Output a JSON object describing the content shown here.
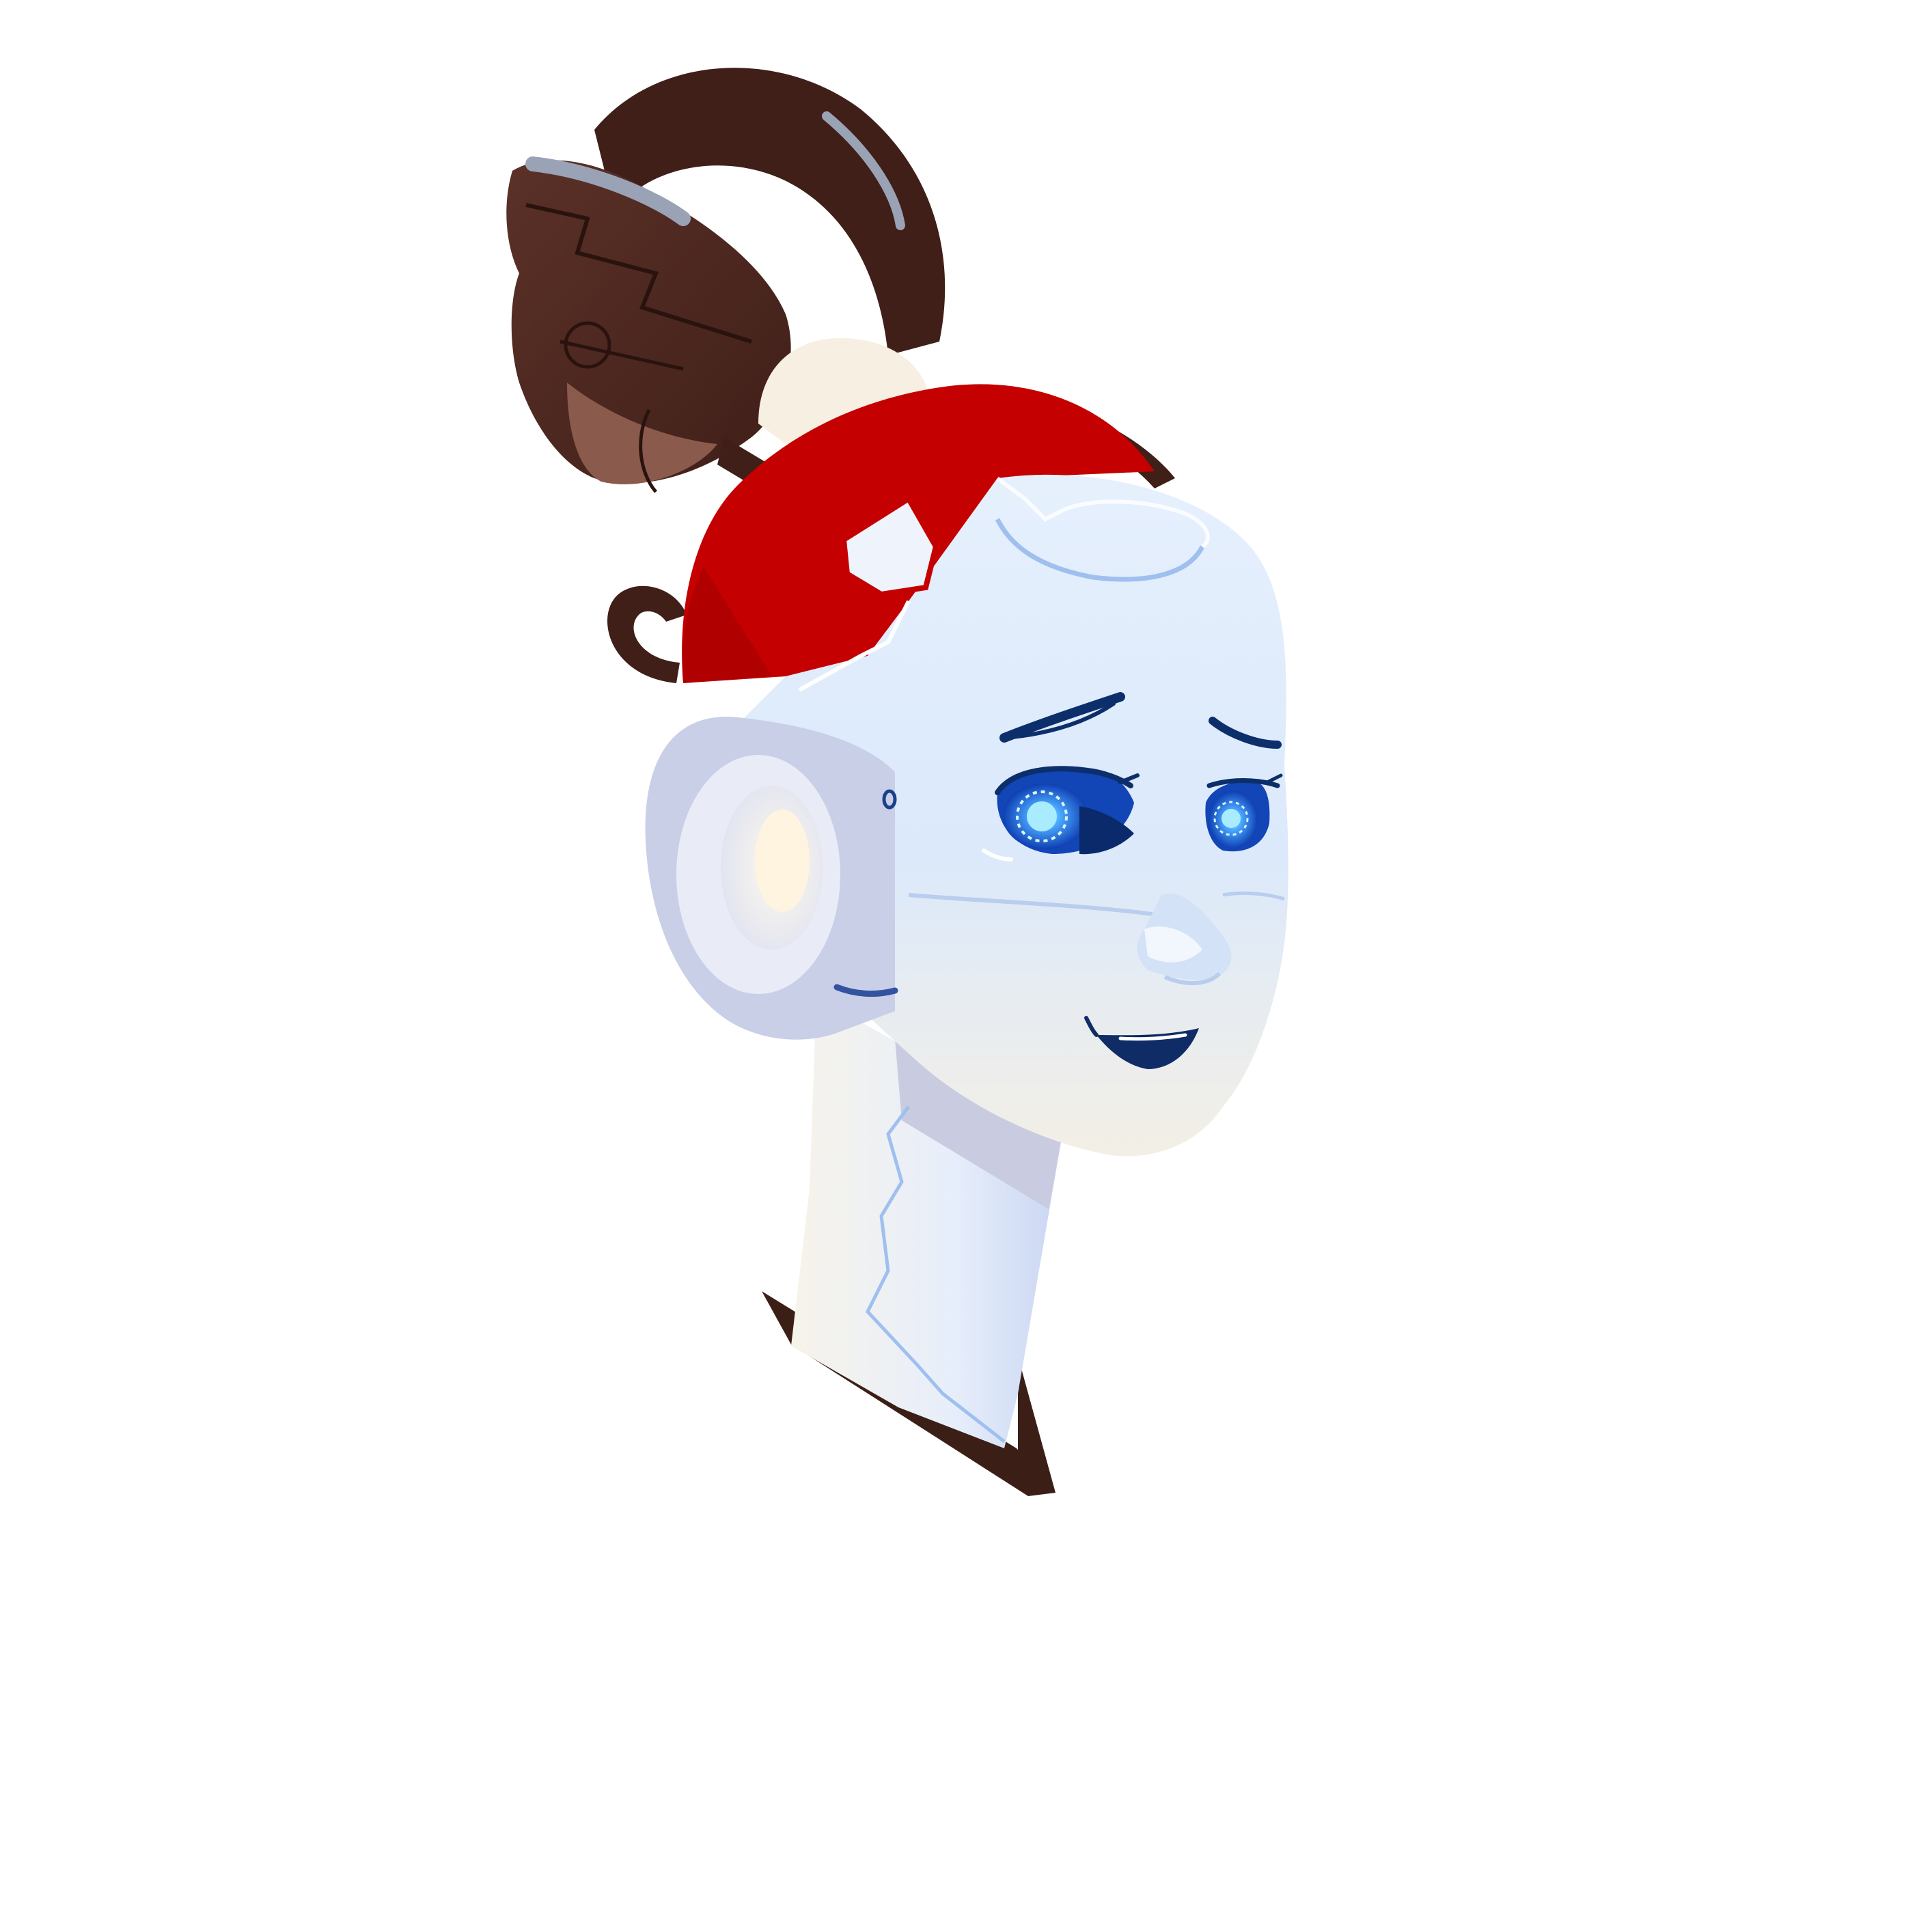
{
  "image": {
    "subject": "robot-head-illustration",
    "colors": {
      "background": "#ffffff",
      "face_light": "#eef5ff",
      "face_mid": "#d6e7fb",
      "face_shadow": "#b9cdee",
      "line_blue": "#9fc0ef",
      "helmet_red": "#c40000",
      "helmet_red_dark": "#8f0000",
      "hair_dark": "#3f1f18",
      "hair_mid": "#5b3128",
      "hair_light": "#8a5a4c",
      "hair_highlight": "#9aa2b6",
      "eye_glow": "#1e6fe8",
      "eye_core": "#7ad0ff",
      "eye_dark": "#0b2a6b",
      "brow": "#0c2f6b",
      "mouth": "#0f2c66",
      "ear_outer": "#c8cfe6",
      "ear_inner": "#f6efe2",
      "neck_shadow": "#c9cbe0",
      "collar": "#3b1f17"
    }
  }
}
